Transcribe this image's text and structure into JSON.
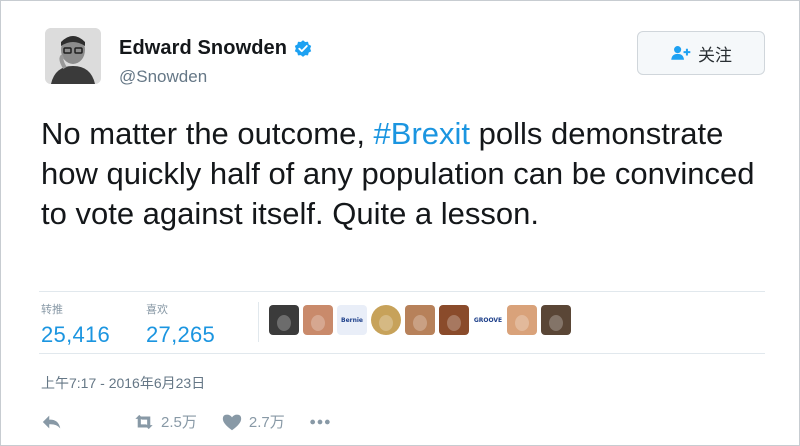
{
  "user": {
    "name": "Edward Snowden",
    "handle": "@Snowden",
    "verified": true
  },
  "follow_button": {
    "label": "关注",
    "icon": "follow-person-icon"
  },
  "tweet": {
    "text_before": "No matter the outcome, ",
    "hashtag": "#Brexit",
    "text_after": " polls demonstrate how quickly half of any population can be convinced to vote against itself. Quite a lesson."
  },
  "stats": {
    "retweets": {
      "label": "转推",
      "value": "25,416"
    },
    "likes": {
      "label": "喜欢",
      "value": "27,265"
    }
  },
  "likers": [
    {
      "name": "liker-avatar-1",
      "color": "#3b3b3b"
    },
    {
      "name": "liker-avatar-2",
      "color": "#c98a6b"
    },
    {
      "name": "liker-avatar-3",
      "color": "#e9eef8",
      "text": "Bernie"
    },
    {
      "name": "liker-avatar-4",
      "color": "#c7a25a"
    },
    {
      "name": "liker-avatar-5",
      "color": "#b7815a"
    },
    {
      "name": "liker-avatar-6",
      "color": "#8a4b2b"
    },
    {
      "name": "liker-avatar-7",
      "color": "#ffffff",
      "text": "GROOVE"
    },
    {
      "name": "liker-avatar-8",
      "color": "#d9a27a"
    },
    {
      "name": "liker-avatar-9",
      "color": "#5a4636"
    }
  ],
  "timestamp": "上午7:17 - 2016年6月23日",
  "actions": {
    "reply_icon": "reply-icon",
    "retweet": {
      "icon": "retweet-icon",
      "count": "2.5万"
    },
    "like": {
      "icon": "heart-icon",
      "count": "2.7万"
    },
    "more_icon": "more-dots-icon"
  },
  "colors": {
    "link": "#1b95e0",
    "muted": "#657786",
    "verified": "#1da1f2"
  }
}
